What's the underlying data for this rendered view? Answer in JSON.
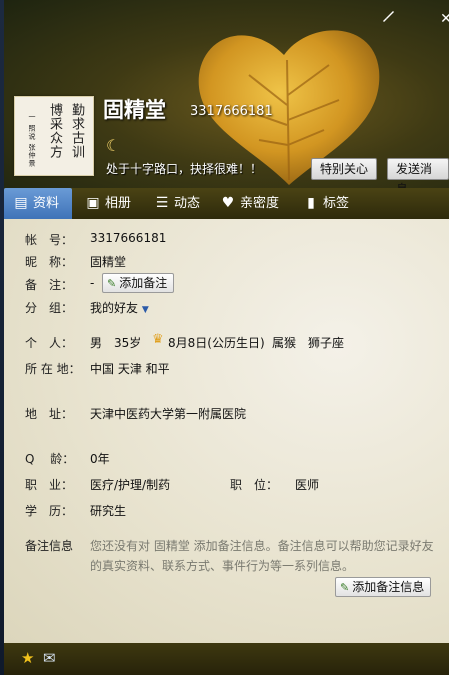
{
  "window": {
    "minimize_icon": "brush-icon",
    "close_label": "✕"
  },
  "profile": {
    "nickname": "固精堂",
    "qq_number": "3317666181",
    "signature": "处于十字路口，抉择很难！！",
    "avatar_text": {
      "col1": "勤求古训",
      "col2": "博采众方",
      "small": "一 照说 张仲景"
    }
  },
  "buttons": {
    "care": "特别关心",
    "send_msg": "发送消息"
  },
  "tabs": [
    {
      "label": "资料",
      "icon": "profile-card-icon",
      "active": true
    },
    {
      "label": "相册",
      "icon": "photo-album-icon",
      "active": false
    },
    {
      "label": "动态",
      "icon": "feed-list-icon",
      "active": false
    },
    {
      "label": "亲密度",
      "icon": "heart-icon",
      "active": false
    },
    {
      "label": "标签",
      "icon": "bookmark-icon",
      "active": false
    }
  ],
  "info": {
    "account_label": "帐　号：",
    "account_value": "3317666181",
    "nickname_label": "昵　称：",
    "nickname_value": "固精堂",
    "remark_label": "备　注：",
    "remark_value": "-",
    "add_remark_label": "添加备注",
    "group_label": "分　组：",
    "group_value": "我的好友",
    "personal_label": "个　人：",
    "gender": "男",
    "age": "35岁",
    "birthday": "8月8日(公历生日)",
    "zodiac": "属猴",
    "star_sign": "狮子座",
    "location_label": "所 在 地：",
    "location_value": "中国 天津 和平",
    "address_label": "地　址：",
    "address_value": "天津中医药大学第一附属医院",
    "qage_label": "Q　 龄：",
    "qage_value": "0年",
    "job_label": "职　业：",
    "job_value": "医疗/护理/制药",
    "position_label": "职　位：",
    "position_value": "医师",
    "edu_label": "学　历：",
    "edu_value": "研究生",
    "note_label": "备注信息",
    "note_text": "您还没有对 固精堂 添加备注信息。备注信息可以帮助您记录好友的真实资料、联系方式、事件行为等一系列信息。",
    "add_note_label": "添加备注信息"
  },
  "colors": {
    "active_tab": "#4f86c8",
    "header_dark": "#2e2a0b",
    "leaf": "#e0a62a"
  }
}
